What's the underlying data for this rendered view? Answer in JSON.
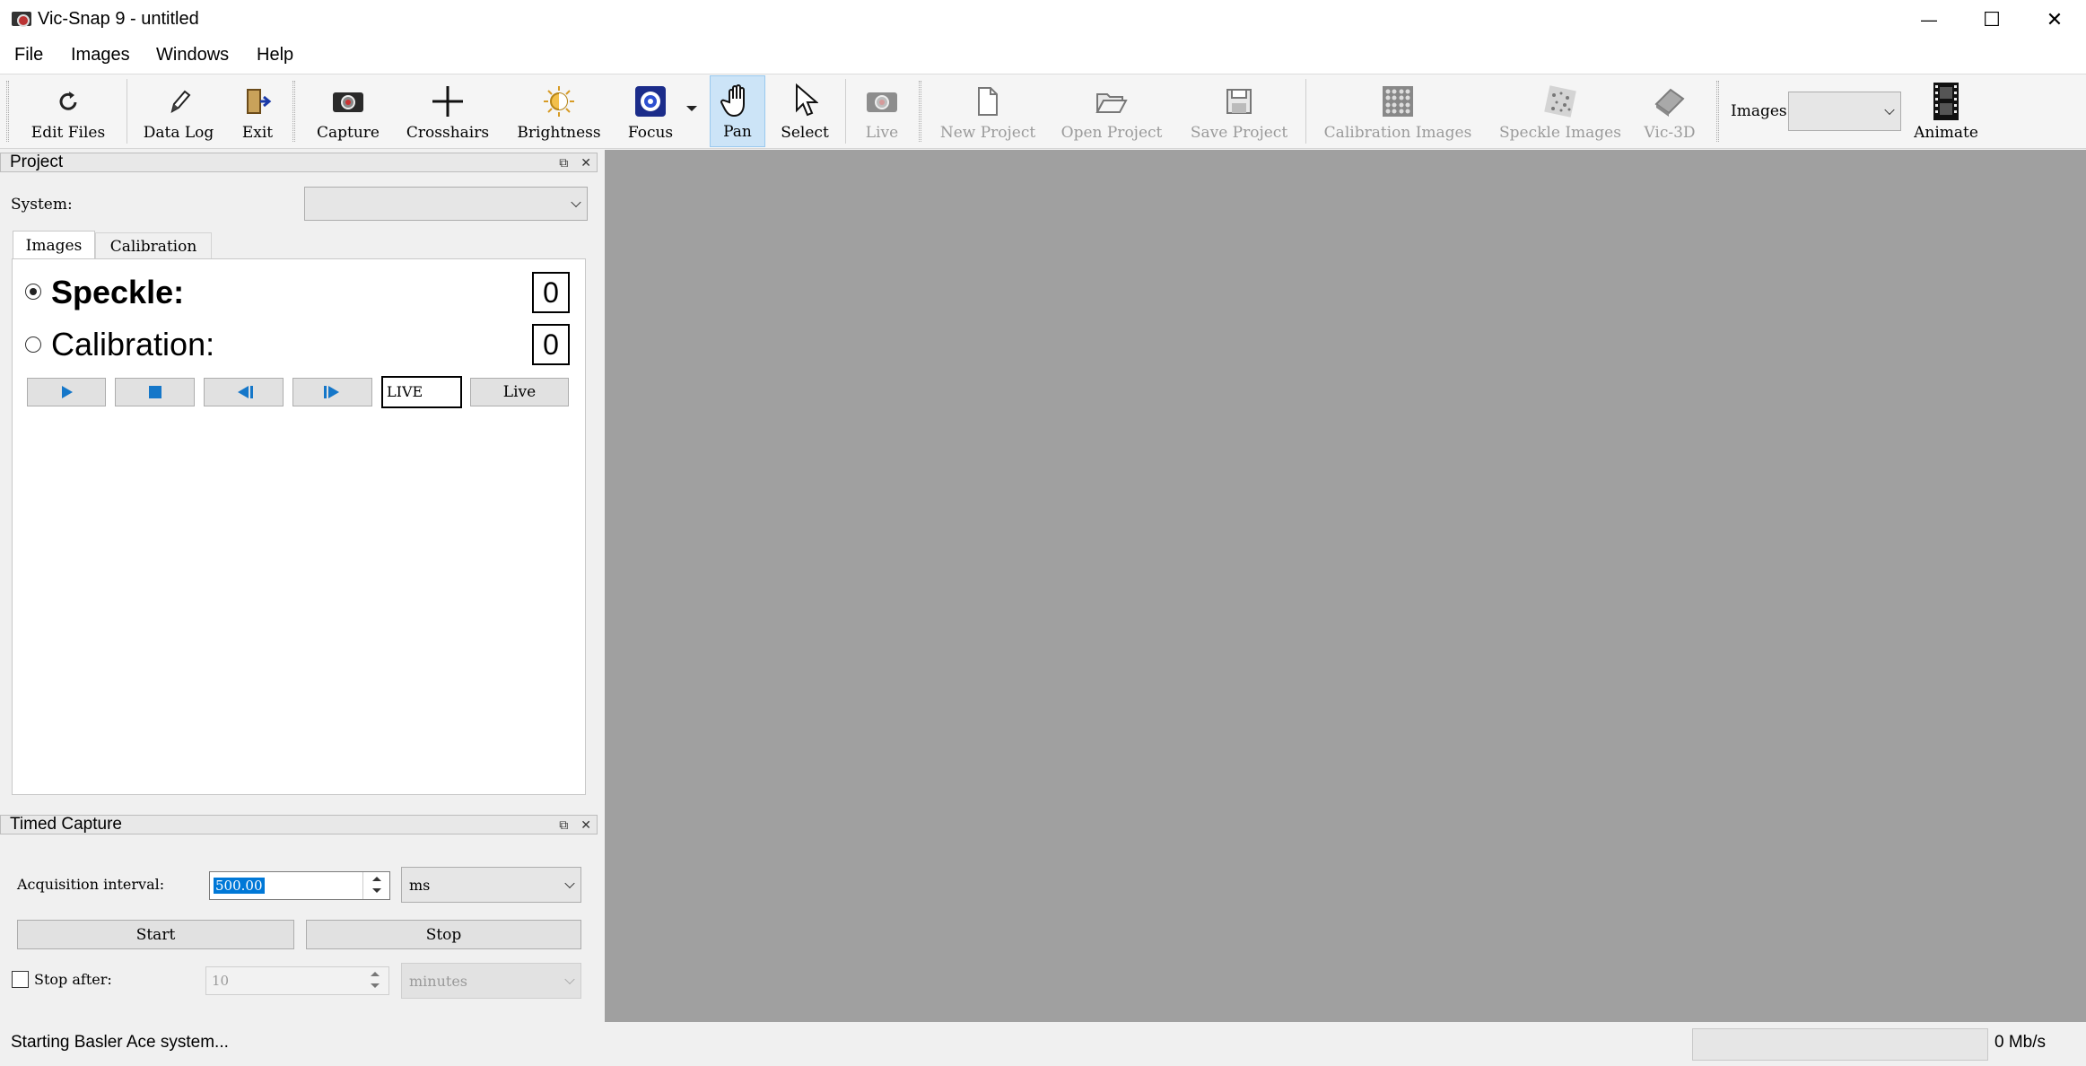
{
  "window": {
    "title": "Vic-Snap 9 - untitled",
    "minimize": "—",
    "maximize": "☐",
    "close": "✕"
  },
  "menu": [
    "File",
    "Images",
    "Windows",
    "Help"
  ],
  "toolbar": {
    "edit_files": "Edit Files",
    "data_log": "Data Log",
    "exit": "Exit",
    "capture": "Capture",
    "crosshairs": "Crosshairs",
    "brightness": "Brightness",
    "focus": "Focus",
    "pan": "Pan",
    "select": "Select",
    "live": "Live",
    "new_project": "New Project",
    "open_project": "Open Project",
    "save_project": "Save Project",
    "calibration_images": "Calibration Images",
    "speckle_images": "Speckle Images",
    "vic3d": "Vic-3D",
    "images_label": "Images:",
    "images_value": "",
    "animate": "Animate"
  },
  "project": {
    "title": "Project",
    "system_label": "System:",
    "system_value": "",
    "tabs": [
      "Images",
      "Calibration"
    ],
    "speckle_label": "Speckle:",
    "speckle_count": "0",
    "calibration_label": "Calibration:",
    "calibration_count": "0",
    "live_field": "LIVE",
    "live_button": "Live"
  },
  "timed_capture": {
    "title": "Timed Capture",
    "interval_label": "Acquisition interval:",
    "interval_value": "500.00",
    "interval_unit": "ms",
    "start": "Start",
    "stop": "Stop",
    "stop_after_label": "Stop after:",
    "stop_after_value": "10",
    "stop_after_unit": "minutes"
  },
  "status": {
    "message": "Starting Basler Ace system...",
    "rate": "0 Mb/s"
  }
}
